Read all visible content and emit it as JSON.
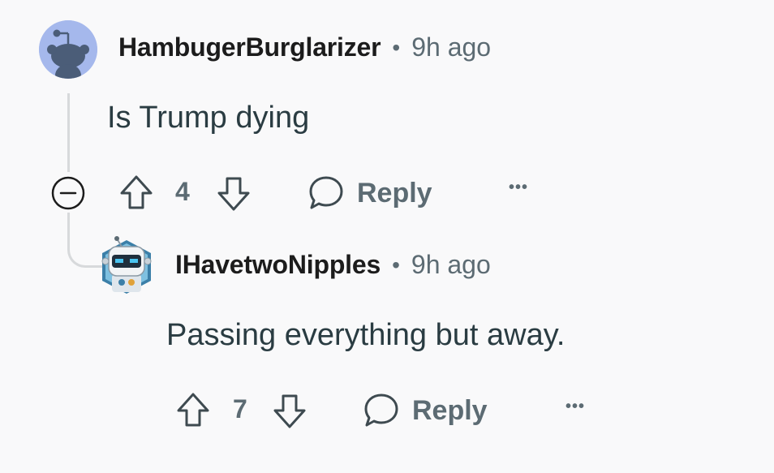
{
  "comments": [
    {
      "username": "HambugerBurglarizer",
      "separator": "•",
      "time": "9h ago",
      "body": "Is Trump dying",
      "votes": "4",
      "reply_label": "Reply",
      "more_label": "•••",
      "avatar": "snoo-default-avatar"
    },
    {
      "username": "IHavetwoNipples",
      "separator": "•",
      "time": "9h ago",
      "body": "Passing everything but away.",
      "votes": "7",
      "reply_label": "Reply",
      "more_label": "•••",
      "avatar": "robot-avatar"
    }
  ],
  "colors": {
    "background": "#f9f9fa",
    "text_primary": "#1c1c1c",
    "text_body": "#2a3c42",
    "text_meta": "#5c6b73",
    "thread_line": "#d7d9db",
    "avatar_bg": "#a5b8ec"
  },
  "icons": [
    "collapse-icon",
    "upvote-icon",
    "downvote-icon",
    "reply-icon",
    "more-icon"
  ]
}
